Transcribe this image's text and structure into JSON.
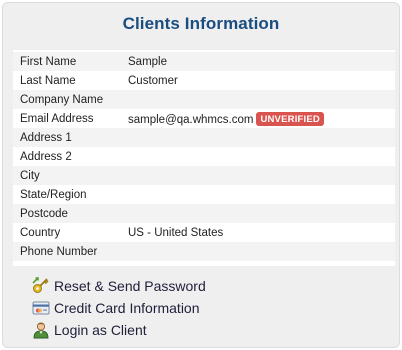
{
  "panel": {
    "title": "Clients Information"
  },
  "client": {
    "rows": [
      {
        "label": "First Name",
        "value": "Sample"
      },
      {
        "label": "Last Name",
        "value": "Customer"
      },
      {
        "label": "Company Name",
        "value": ""
      },
      {
        "label": "Email Address",
        "value": "sample@qa.whmcs.com",
        "badge": "UNVERIFIED"
      },
      {
        "label": "Address 1",
        "value": ""
      },
      {
        "label": "Address 2",
        "value": ""
      },
      {
        "label": "City",
        "value": ""
      },
      {
        "label": "State/Region",
        "value": ""
      },
      {
        "label": "Postcode",
        "value": ""
      },
      {
        "label": "Country",
        "value": "US - United States"
      },
      {
        "label": "Phone Number",
        "value": ""
      }
    ]
  },
  "actions": [
    {
      "label": "Reset & Send Password",
      "icon": "key-icon"
    },
    {
      "label": "Credit Card Information",
      "icon": "credit-card-icon"
    },
    {
      "label": "Login as Client",
      "icon": "user-icon"
    }
  ],
  "colors": {
    "title": "#1a4d80",
    "badge": "#d9534f",
    "panel_bg": "#efefef",
    "row_alt": "#f3f3f3"
  }
}
